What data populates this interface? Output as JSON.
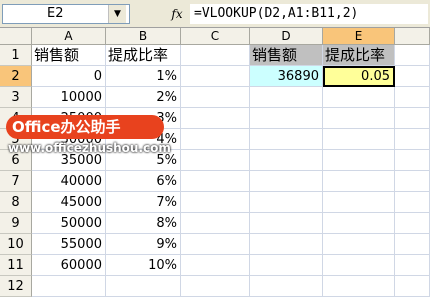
{
  "formula_bar": {
    "name_box": "E2",
    "dropdown_arrow": "▼",
    "fx_label": "fx",
    "formula": "=VLOOKUP(D2,A1:B11,2)"
  },
  "columns": [
    "A",
    "B",
    "C",
    "D",
    "E"
  ],
  "active_column": "E",
  "active_row": "2",
  "rows": [
    {
      "num": "1",
      "A": "销售额",
      "B": "提成比率",
      "C": "",
      "D": "销售额",
      "E": "提成比率"
    },
    {
      "num": "2",
      "A": "0",
      "B": "1%",
      "C": "",
      "D": "36890",
      "E": "0.05"
    },
    {
      "num": "3",
      "A": "10000",
      "B": "2%",
      "C": "",
      "D": "",
      "E": ""
    },
    {
      "num": "4",
      "A": "25000",
      "B": "3%",
      "C": "",
      "D": "",
      "E": ""
    },
    {
      "num": "5",
      "A": "30000",
      "B": "4%",
      "C": "",
      "D": "",
      "E": ""
    },
    {
      "num": "6",
      "A": "35000",
      "B": "5%",
      "C": "",
      "D": "",
      "E": ""
    },
    {
      "num": "7",
      "A": "40000",
      "B": "6%",
      "C": "",
      "D": "",
      "E": ""
    },
    {
      "num": "8",
      "A": "45000",
      "B": "7%",
      "C": "",
      "D": "",
      "E": ""
    },
    {
      "num": "9",
      "A": "50000",
      "B": "8%",
      "C": "",
      "D": "",
      "E": ""
    },
    {
      "num": "10",
      "A": "55000",
      "B": "9%",
      "C": "",
      "D": "",
      "E": ""
    },
    {
      "num": "11",
      "A": "60000",
      "B": "10%",
      "C": "",
      "D": "",
      "E": ""
    },
    {
      "num": "12",
      "A": "",
      "B": "",
      "C": "",
      "D": "",
      "E": ""
    }
  ],
  "colors": {
    "d_header_fill": "#c0c0c0",
    "d2_fill": "#ccffff",
    "e2_fill": "#ffff99",
    "active_header": "#f9c57a",
    "logo_red": "#e8421e"
  },
  "watermark": {
    "logo_text": "Office办公助手",
    "url": "www.officezhushou.com"
  }
}
